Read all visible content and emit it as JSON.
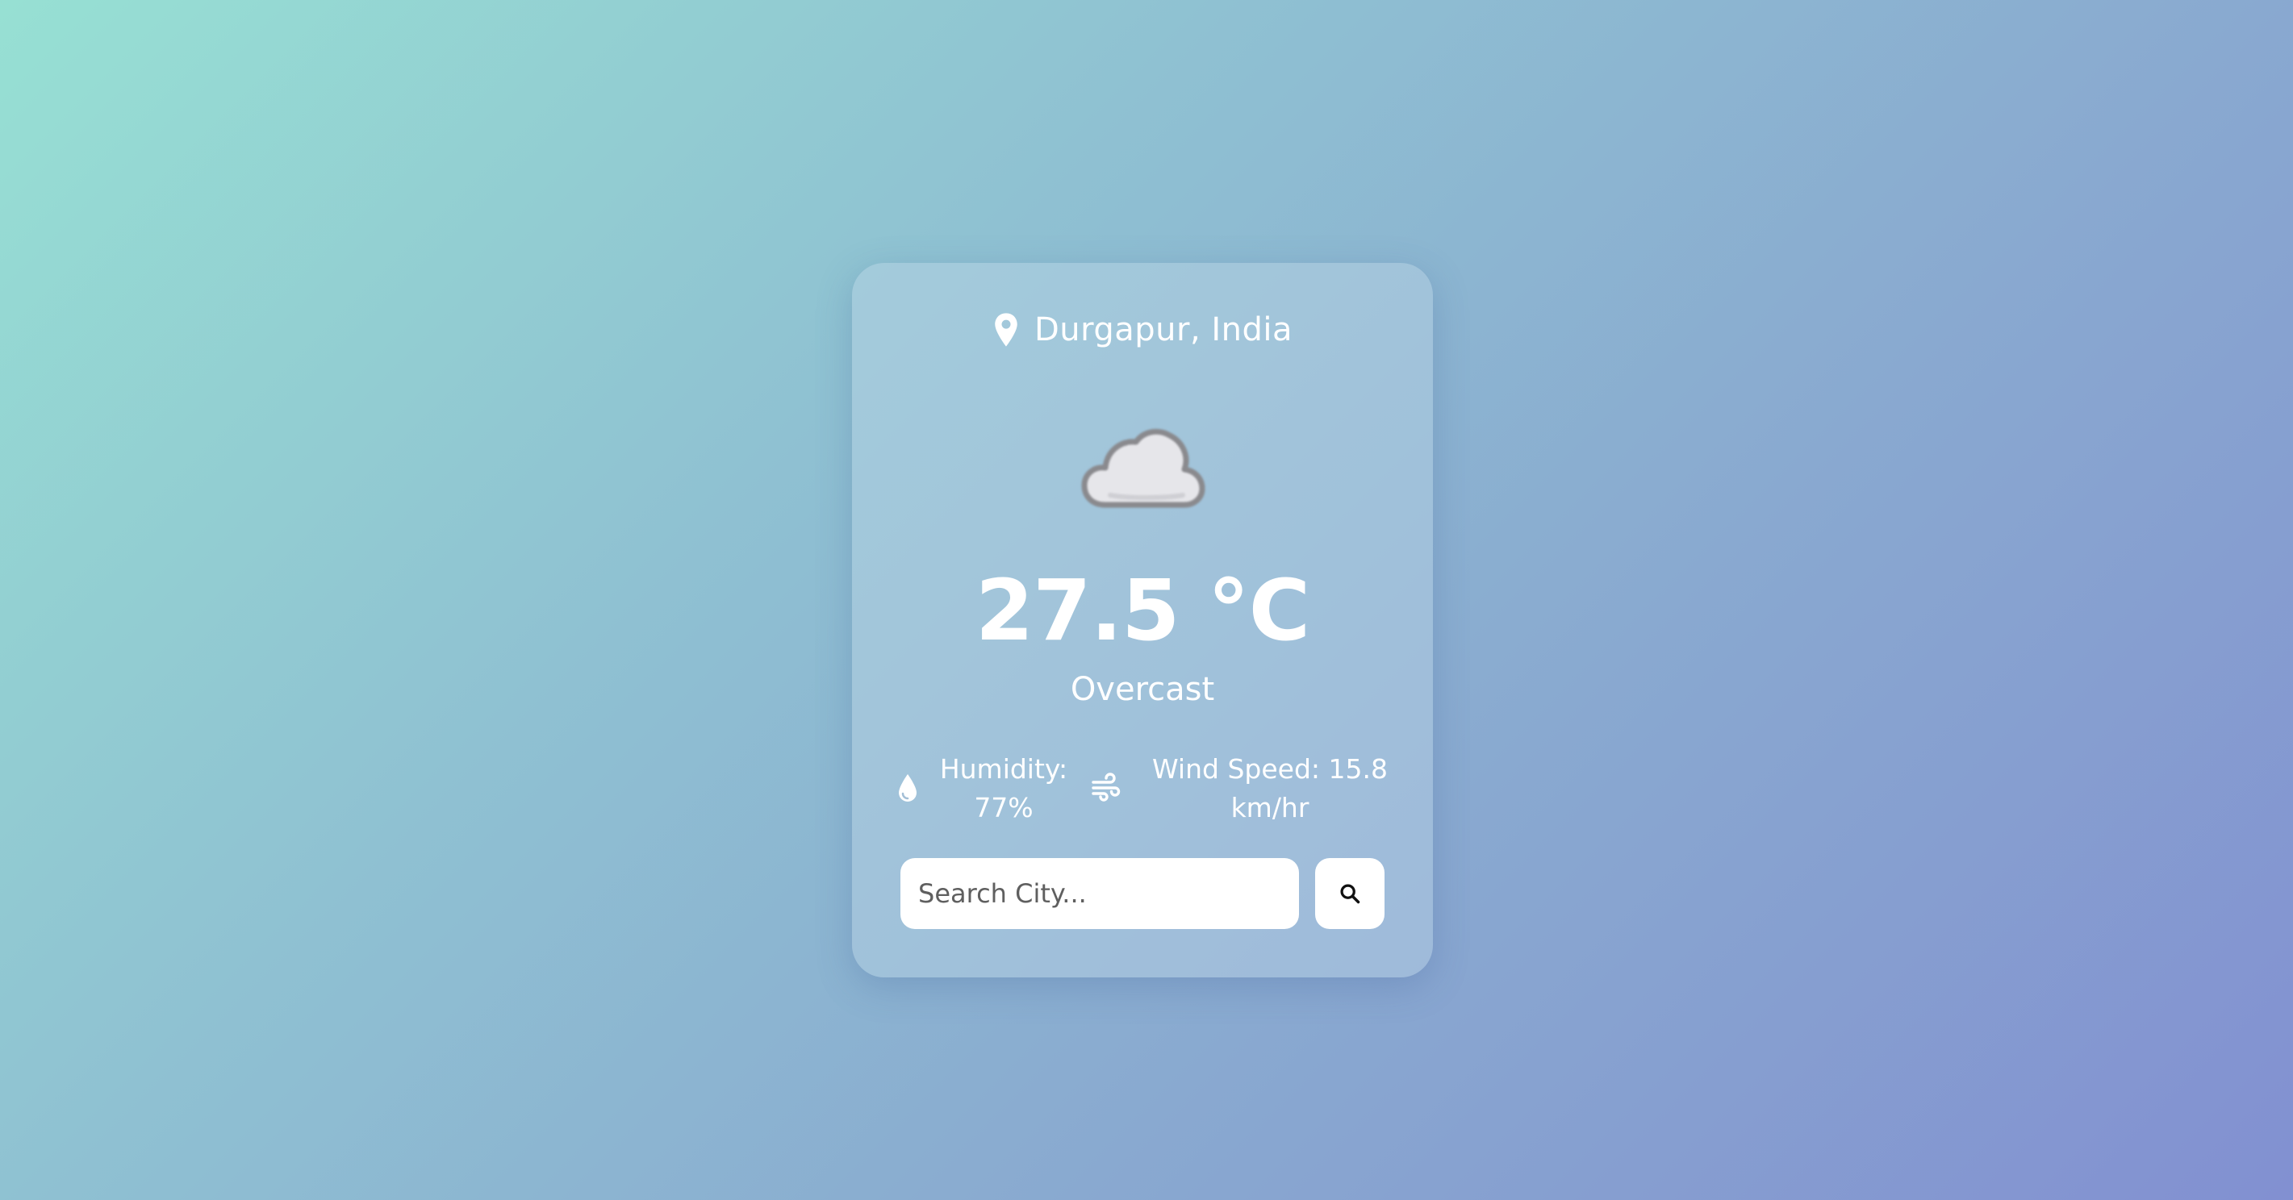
{
  "location": {
    "icon": "map-pin-icon",
    "text": "Durgapur, India"
  },
  "weather": {
    "icon": "cloud-icon",
    "temperature": "27.5 °C",
    "condition": "Overcast"
  },
  "details": {
    "humidity": {
      "icon": "water-drop-icon",
      "line1": "Humidity:",
      "line2": "77%"
    },
    "wind": {
      "icon": "wind-icon",
      "line1": "Wind Speed: 15.8",
      "line2": "km/hr"
    }
  },
  "search": {
    "placeholder": "Search City...",
    "value": "",
    "button_icon": "search-icon"
  },
  "colors": {
    "background_start": "#97e0d3",
    "background_end": "#8290d1",
    "text": "#ffffff",
    "input_background": "#ffffff"
  }
}
